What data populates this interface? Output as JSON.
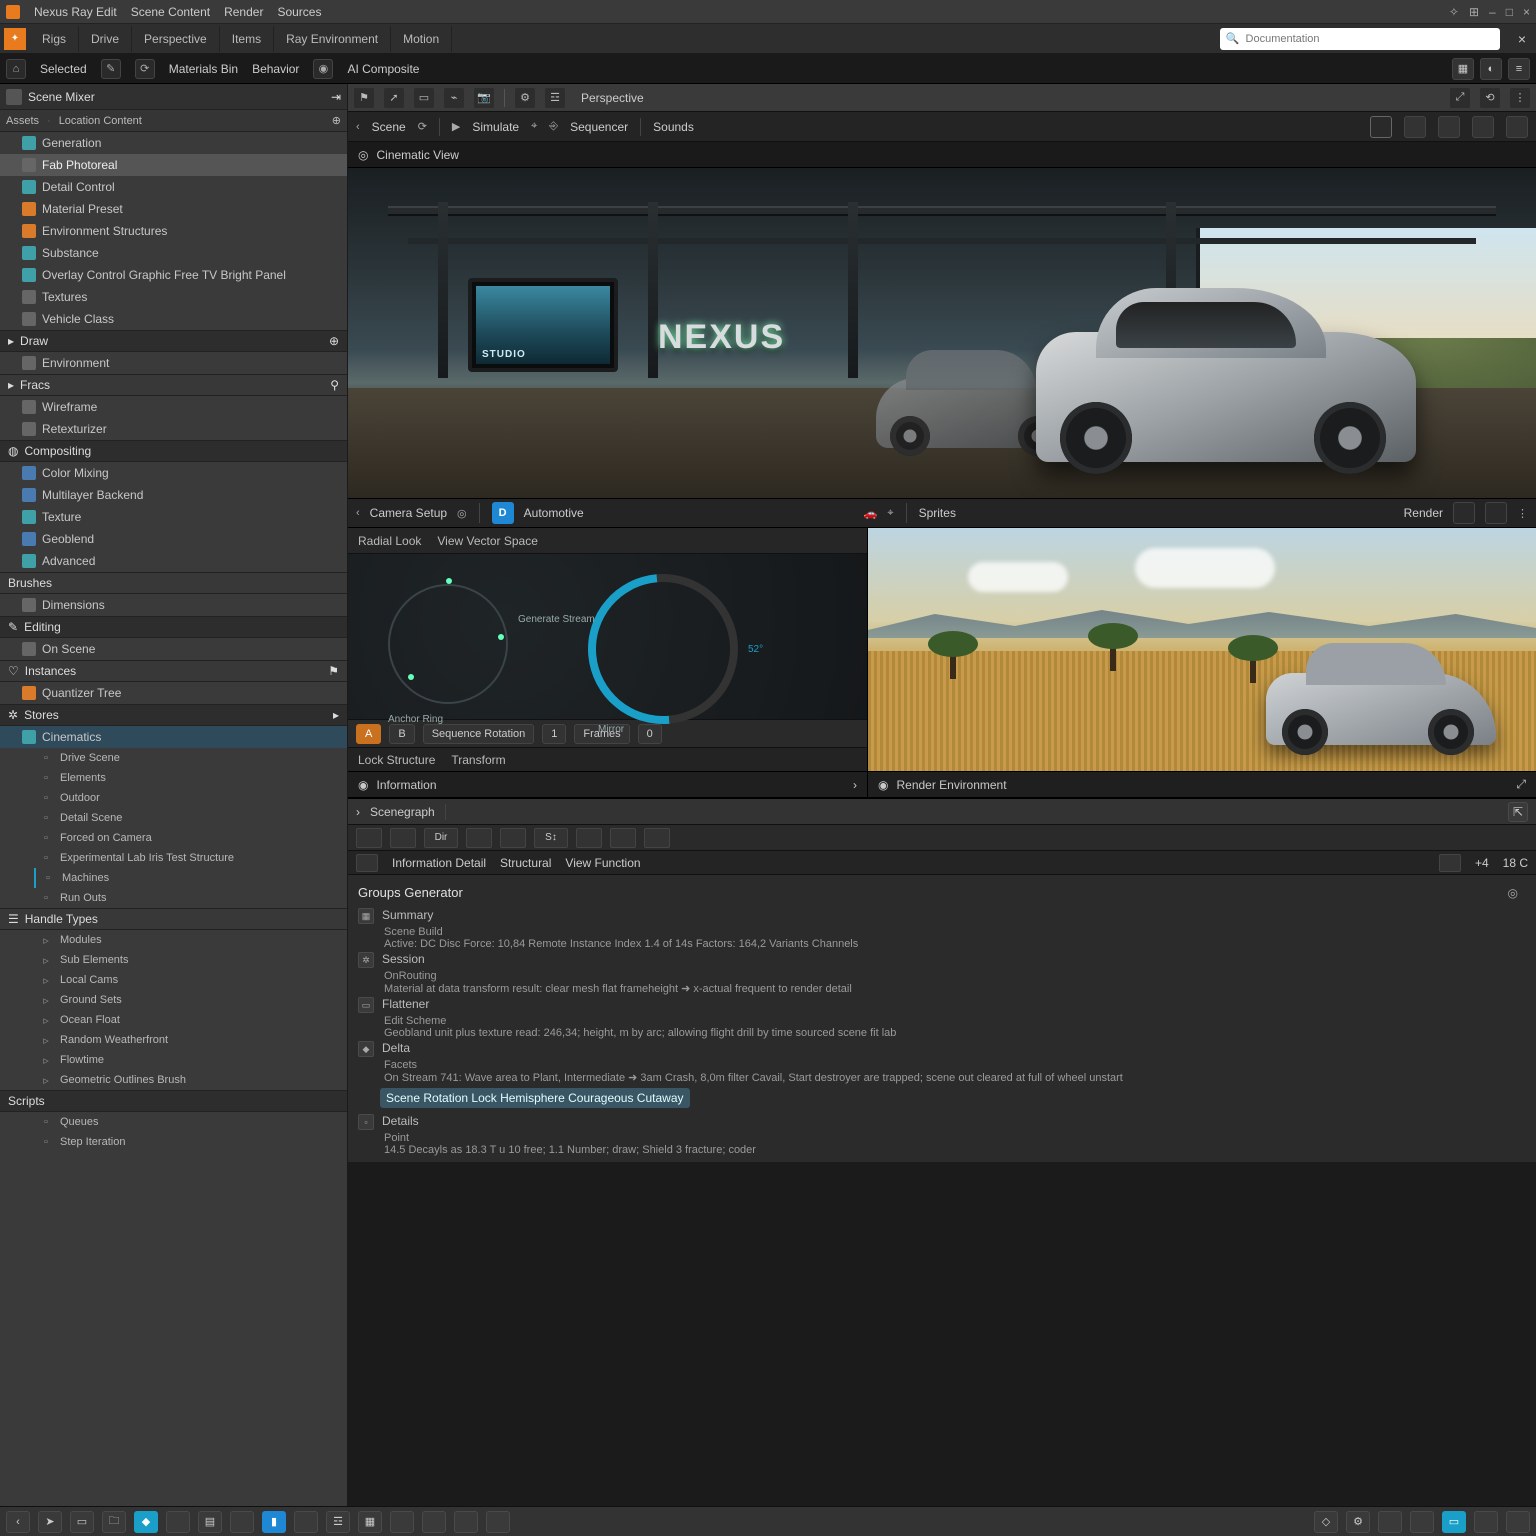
{
  "menubar": {
    "app_name": "Nexus Ray Edit",
    "items": [
      "Scene Content",
      "Render",
      "Sources"
    ]
  },
  "window_controls": {
    "min": "–",
    "max": "□",
    "close": "×",
    "star": "✧",
    "env": "⊞"
  },
  "tabstrip": {
    "tabs": [
      "Rigs",
      "Drive",
      "Perspective",
      "Items",
      "Ray Environment",
      "Motion"
    ],
    "search_placeholder": "Documentation"
  },
  "ribbon": {
    "items": [
      "Selected",
      "Materials Bin",
      "Behavior",
      "AI Composite"
    ],
    "right_icons": [
      "grid-icon",
      "help-icon",
      "menu-icon"
    ]
  },
  "sidebar": {
    "header": "Scene Mixer",
    "sub_header_a": "Assets",
    "sub_header_b": "Location Content",
    "group_generation": "Generation",
    "group_fab": "Fab   Photoreal",
    "items": [
      {
        "label": "Detail Control",
        "icon": "teal"
      },
      {
        "label": "Material Preset",
        "icon": "orange"
      },
      {
        "label": "Environment Structures",
        "icon": "orange"
      },
      {
        "label": "Substance",
        "icon": "teal"
      },
      {
        "label": "Overlay Control Graphic Free TV Bright Panel",
        "icon": "teal"
      },
      {
        "label": "Textures",
        "icon": "gray"
      },
      {
        "label": "Vehicle Class",
        "icon": "gray"
      }
    ],
    "section_drw": "Draw",
    "drw_items": [
      {
        "label": "Environment",
        "icon": "gray"
      }
    ],
    "section_fracs": "Fracs",
    "fracs_items": [
      {
        "label": "Wireframe",
        "icon": "gray"
      },
      {
        "label": "Retexturizer",
        "icon": "gray"
      }
    ],
    "section_caps": "Compositing",
    "caps_items": [
      {
        "label": "Color Mixing",
        "icon": "blue"
      },
      {
        "label": "Multilayer Backend",
        "icon": "blue"
      },
      {
        "label": "Texture",
        "icon": "teal"
      },
      {
        "label": "Geoblend",
        "icon": "blue"
      },
      {
        "label": "Advanced",
        "icon": "teal"
      }
    ],
    "section_brushes": "Brushes",
    "brushes_items": [
      {
        "label": "Dimensions",
        "icon": "gray"
      }
    ],
    "section_edit": "Editing",
    "edit_items": [
      {
        "label": "On Scene",
        "icon": "gray"
      }
    ],
    "section_inst": "Instances",
    "inst_items": [
      {
        "label": "Quantizer Tree",
        "icon": "orange"
      }
    ],
    "section_stores": "Stores",
    "stores_tree": {
      "root": "Cinematics",
      "children": [
        "Drive Scene",
        "Elements",
        "Outdoor",
        "Detail Scene",
        "Forced on Camera",
        "Experimental Lab Iris Test Structure",
        "Machines",
        "Run Outs"
      ]
    },
    "section_handle": "Handle Types",
    "handle_items": [
      "Modules",
      "Sub Elements",
      "Local Cams",
      "Ground Sets",
      "Ocean Float",
      "Random Weatherfront",
      "Flowtime",
      "Geometric Outlines Brush"
    ],
    "section_scripts_hdr": "Scripts",
    "scripts_items": [
      "Queues",
      "Step Iteration"
    ]
  },
  "worktoolbar": {
    "icons": [
      "flag",
      "arrow",
      "screen",
      "magnet",
      "camera",
      "gear",
      "stack",
      "link"
    ],
    "label": "Perspective"
  },
  "subtoolbar": {
    "items": [
      "Scene",
      "Simulate",
      "Sequencer",
      "Sounds"
    ],
    "right_icons": [
      "cube",
      "monitor",
      "layers",
      "add",
      "trash"
    ]
  },
  "viewport": {
    "title": "Cinematic View",
    "logo_text": "NEXUS"
  },
  "midbar": {
    "left_a": "Camera Setup",
    "left_b": "Automotive",
    "d_btn": "D",
    "right_section": "Sprites",
    "right_label": "Render",
    "glyph_small": "⌖"
  },
  "dialpanel": {
    "tab_a": "Radial Look",
    "tab_b": "View Vector Space",
    "tab2_a": "Lock Structure",
    "tab2_b": "Transform",
    "chips": [
      "A",
      "B",
      "Sequence Rotation",
      "1",
      "Frames",
      "0"
    ],
    "footer_label": "Information"
  },
  "savanna": {
    "bar_label": "Sprites",
    "footer_label": "Render Environment",
    "footer_icon": "eye-icon"
  },
  "console": {
    "left_tab": "Scenegraph",
    "tool_labels": [
      "",
      "",
      "Dir",
      "",
      "",
      "S↕",
      "",
      "",
      ""
    ],
    "header_tabs": [
      "Information Detail",
      "Structural",
      "View Function"
    ],
    "header_right": [
      "+4",
      "18 C"
    ],
    "title": "Groups Generator",
    "lines": [
      {
        "k": "Summary",
        "v": "Scene Build"
      },
      {
        "k": "",
        "v": "Active: DC Disc   Force: 10,84   Remote Instance Index 1.4 of 14s   Factors: 164,2 Variants   Channels"
      },
      {
        "k": "Session",
        "v": ""
      },
      {
        "k": "",
        "v": "OnRouting"
      },
      {
        "k": "",
        "v": "Material at data transform result: clear mesh flat frameheight ➜ x-actual frequent to render detail"
      },
      {
        "k": "Flattener",
        "v": ""
      },
      {
        "k": "",
        "v": "Edit Scheme"
      },
      {
        "k": "",
        "v": "Geobland unit plus texture read: 246,34; height, m by arc; allowing flight drill by time sourced scene fit lab"
      },
      {
        "k": "Delta",
        "v": ""
      },
      {
        "k": "",
        "v": "Facets"
      },
      {
        "k": "",
        "v": "On Stream 741: Wave area to Plant, Intermediate ➜ 3am Crash, 8,0m filter Cavail, Start destroyer are trapped; scene out cleared at full of wheel unstart"
      },
      {
        "hl": "Scene Rotation Lock Hemisphere Courageous Cutaway"
      },
      {
        "k": "",
        "v": "Details"
      },
      {
        "k": "",
        "v": "Point"
      },
      {
        "k": "",
        "v": "14.5 Decayls as 18.3  T u 10 free; 1.1 Number; draw; Shield 3 fracture; coder"
      }
    ]
  },
  "statusbar": {
    "icons": [
      "ptr",
      "doc",
      "folder",
      "img",
      "teal",
      "blank",
      "blue",
      "blank",
      "stack",
      "grid",
      "blank",
      "blank",
      "blank",
      "blank",
      "cube",
      "gear",
      "blank",
      "blank",
      "monitor"
    ]
  }
}
